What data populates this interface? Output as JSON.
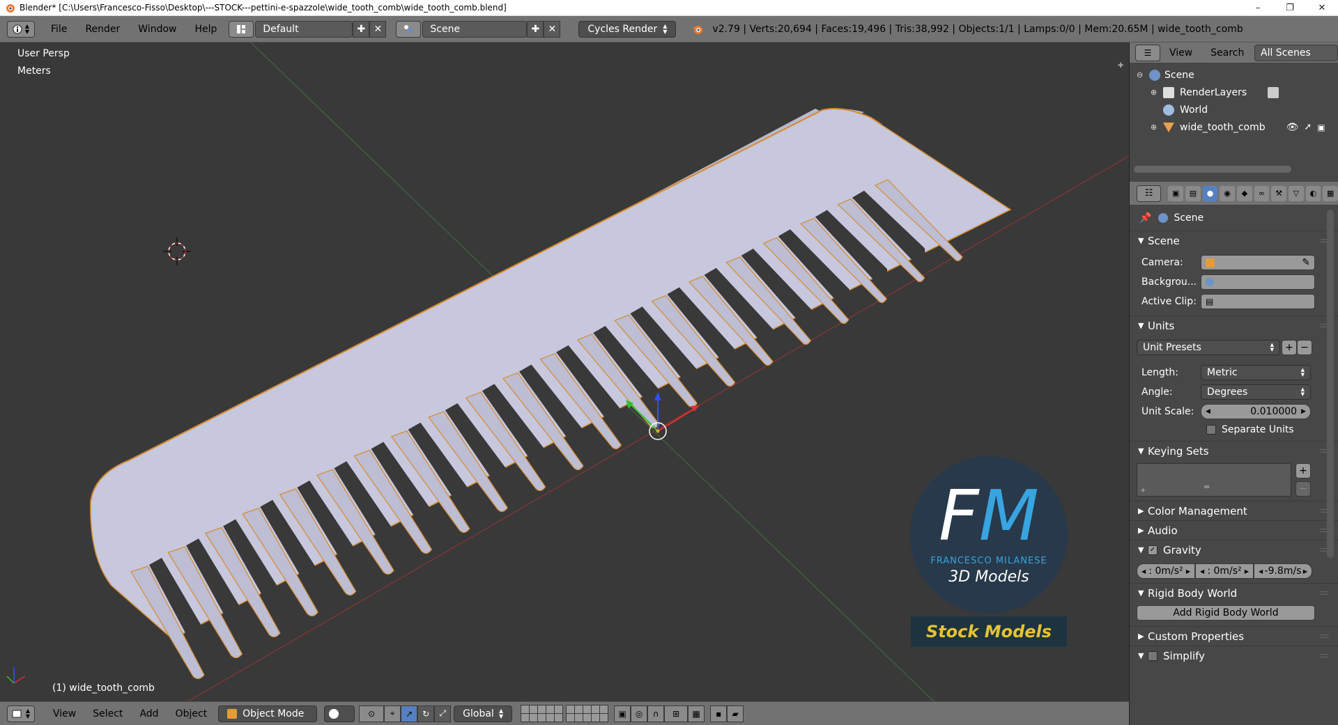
{
  "window": {
    "title": "Blender* [C:\\Users\\Francesco-Fisso\\Desktop\\---STOCK---pettini-e-spazzole\\wide_tooth_comb\\wide_tooth_comb.blend]",
    "minimize": "–",
    "maximize": "❐",
    "close": "✕"
  },
  "info_header": {
    "menus": [
      "File",
      "Render",
      "Window",
      "Help"
    ],
    "screen_layout": "Default",
    "scene": "Scene",
    "render_engine": "Cycles Render",
    "stats": "v2.79 | Verts:20,694 | Faces:19,496 | Tris:38,992 | Objects:1/1 | Lamps:0/0 | Mem:20.65M | wide_tooth_comb"
  },
  "viewport": {
    "view_name": "User Persp",
    "units": "Meters",
    "object_label": "(1) wide_tooth_comb",
    "watermark": {
      "initials_f": "F",
      "initials_m": "M",
      "name": "FRANCESCO MILANESE",
      "subtitle": "3D Models",
      "tag": "Stock Models"
    }
  },
  "bottom_bar": {
    "menus": [
      "View",
      "Select",
      "Add",
      "Object"
    ],
    "mode": "Object Mode",
    "orientation": "Global"
  },
  "outliner": {
    "menus": [
      "View",
      "Search"
    ],
    "display_mode": "All Scenes",
    "items": [
      "Scene",
      "RenderLayers",
      "World",
      "wide_tooth_comb"
    ]
  },
  "properties": {
    "context": "Scene",
    "panels": {
      "scene": {
        "title": "Scene",
        "camera_label": "Camera:",
        "background_label": "Backgrou...",
        "active_clip_label": "Active Clip:"
      },
      "units": {
        "title": "Units",
        "preset": "Unit Presets",
        "length_label": "Length:",
        "length_value": "Metric",
        "angle_label": "Angle:",
        "angle_value": "Degrees",
        "scale_label": "Unit Scale:",
        "scale_value": "0.010000",
        "separate_units": "Separate Units"
      },
      "keying_sets": {
        "title": "Keying Sets"
      },
      "color_management": {
        "title": "Color Management"
      },
      "audio": {
        "title": "Audio"
      },
      "gravity": {
        "title": "Gravity",
        "x": ": 0m/s²",
        "y": ": 0m/s²",
        "z": "-9.8m/s"
      },
      "rigid_body": {
        "title": "Rigid Body World",
        "add_button": "Add Rigid Body World"
      },
      "custom_properties": {
        "title": "Custom Properties"
      },
      "simplify": {
        "title": "Simplify"
      }
    }
  }
}
